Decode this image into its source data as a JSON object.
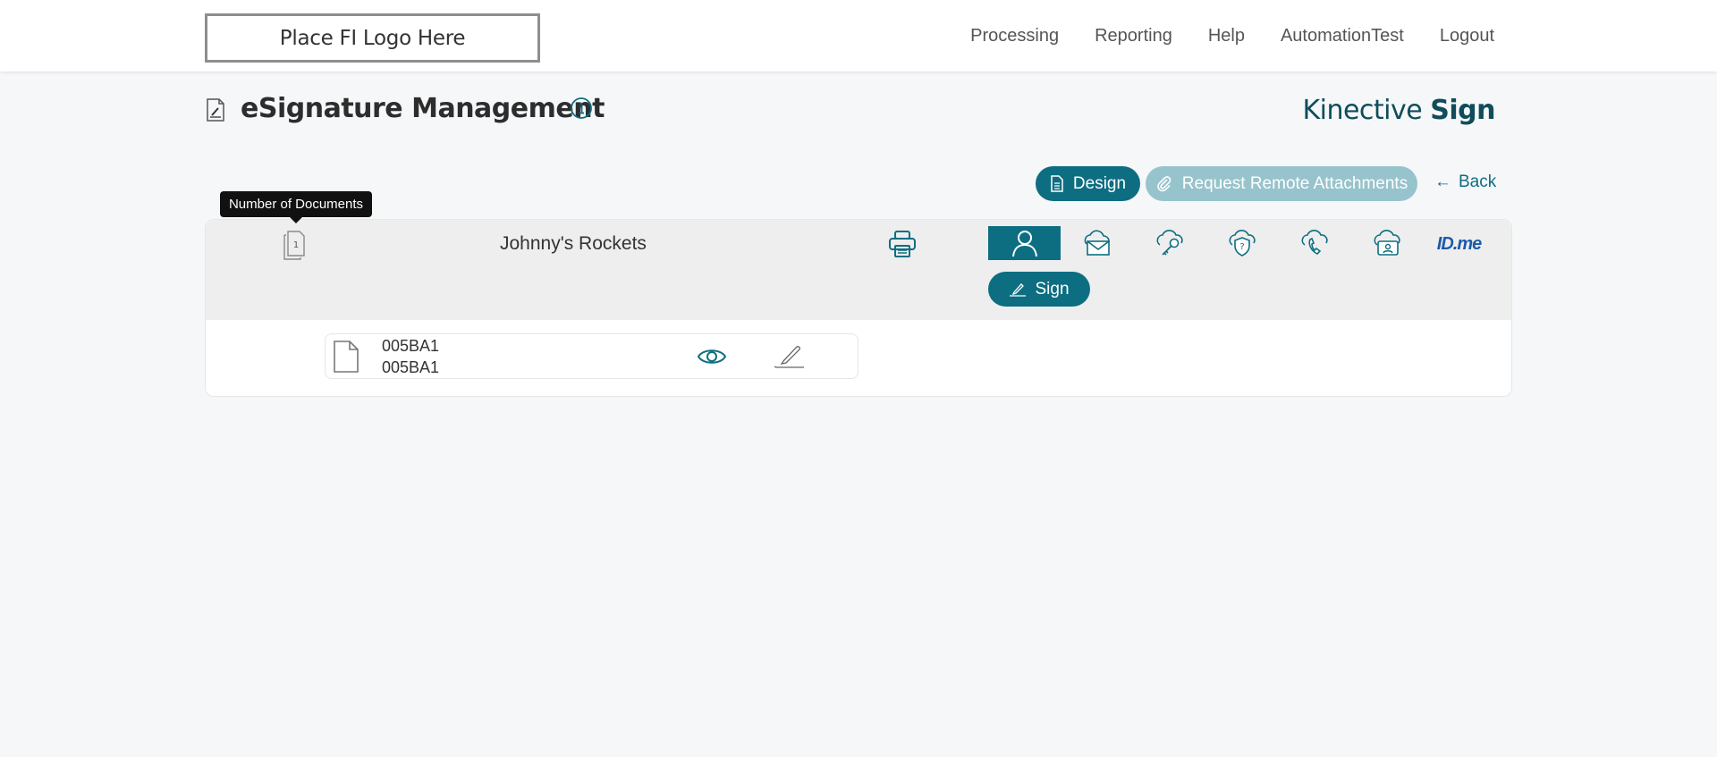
{
  "header": {
    "logo_text": "Place FI Logo Here",
    "nav": [
      "Processing",
      "Reporting",
      "Help",
      "AutomationTest",
      "Logout"
    ]
  },
  "page": {
    "title": "eSignature Management",
    "brand_light": "Kinective",
    "brand_bold": "Sign"
  },
  "actions": {
    "design_label": "Design",
    "request_label": "Request Remote Attachments",
    "back_label": "Back",
    "back_arrow": "←"
  },
  "tooltip": {
    "text": "Number of Documents"
  },
  "signer": {
    "doc_count": "1",
    "name": "Johnny's Rockets",
    "sign_label": "Sign",
    "auth_methods": [
      {
        "icon": "person-icon",
        "active": true
      },
      {
        "icon": "email-cloud-icon",
        "active": false
      },
      {
        "icon": "key-cloud-icon",
        "active": false
      },
      {
        "icon": "question-shield-cloud-icon",
        "active": false
      },
      {
        "icon": "phone-cloud-icon",
        "active": false
      },
      {
        "icon": "id-card-cloud-icon",
        "active": false
      },
      {
        "icon": "idme-logo",
        "active": false
      }
    ],
    "idme_text": "ID",
    "idme_suffix": ".me"
  },
  "document": {
    "line1": "005BA1",
    "line2": "005BA1"
  },
  "colors": {
    "primary": "#0d6e82",
    "primary_disabled": "#97c3cc",
    "brand_text": "#0f4d5a",
    "idme_blue": "#1d5aa8"
  }
}
